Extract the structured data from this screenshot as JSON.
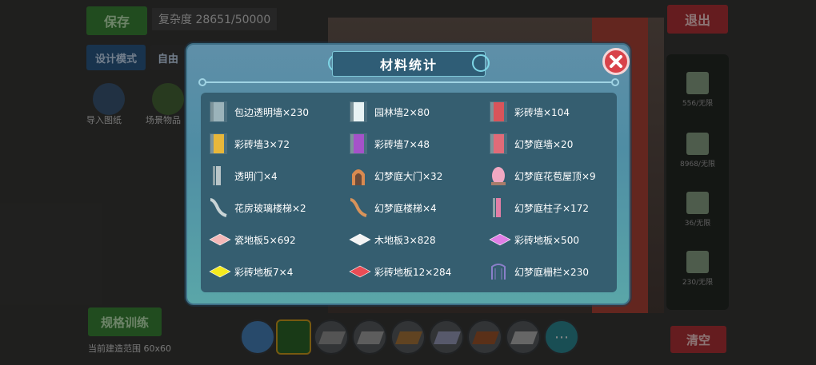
{
  "background": {
    "save_label": "保存",
    "complexity_text": "复杂度 28651/50000",
    "design_mode_label": "设计模式",
    "free_label": "自由",
    "exit_label": "退出",
    "left_icon1_label": "导入图纸",
    "left_icon2_label": "场景物品",
    "training_label": "规格训练",
    "bottom_status": "当前建造范围 60x60",
    "clear_label": "清空",
    "right_panel_items": [
      "556/无限",
      "8968/无限",
      "36/无限",
      "230/无限"
    ]
  },
  "modal": {
    "title": "材料统计",
    "items": [
      {
        "label": "包边透明墙×230",
        "icon": "wall-glass-edge-icon",
        "color": "#9bb3ba"
      },
      {
        "label": "园林墙2×80",
        "icon": "wall-white-icon",
        "color": "#e8f3f4"
      },
      {
        "label": "彩砖墙×104",
        "icon": "wall-red-icon",
        "color": "#d9545a"
      },
      {
        "label": "彩砖墙3×72",
        "icon": "wall-yellow-icon",
        "color": "#e8b73a"
      },
      {
        "label": "彩砖墙7×48",
        "icon": "wall-purple-icon",
        "color": "#a552c9"
      },
      {
        "label": "幻梦庭墙×20",
        "icon": "wall-dream-icon",
        "color": "#e06b78"
      },
      {
        "label": "透明门×4",
        "icon": "door-glass-icon",
        "color": "#b8c5c8"
      },
      {
        "label": "幻梦庭大门×32",
        "icon": "gate-dream-icon",
        "color": "#d98a50"
      },
      {
        "label": "幻梦庭花苞屋顶×9",
        "icon": "roof-bud-icon",
        "color": "#f0a8c2"
      },
      {
        "label": "花房玻璃楼梯×2",
        "icon": "stairs-glass-icon",
        "color": "#c9d4d6"
      },
      {
        "label": "幻梦庭楼梯×4",
        "icon": "stairs-dream-icon",
        "color": "#d8935a"
      },
      {
        "label": "幻梦庭柱子×172",
        "icon": "pillar-dream-icon",
        "color": "#e27ea6"
      },
      {
        "label": "瓷地板5×692",
        "icon": "floor-pink-icon",
        "color": "#f3b8b8"
      },
      {
        "label": "木地板3×828",
        "icon": "floor-white-icon",
        "color": "#f4f4f4"
      },
      {
        "label": "彩砖地板×500",
        "icon": "floor-magenta-icon",
        "color": "#e07ee6"
      },
      {
        "label": "彩砖地板7×4",
        "icon": "floor-yellow-icon",
        "color": "#f5ea1e"
      },
      {
        "label": "彩砖地板12×284",
        "icon": "floor-red-icon",
        "color": "#ea4c55"
      },
      {
        "label": "幻梦庭栅栏×230",
        "icon": "fence-dream-icon",
        "color": "#8a7fc9"
      }
    ]
  }
}
